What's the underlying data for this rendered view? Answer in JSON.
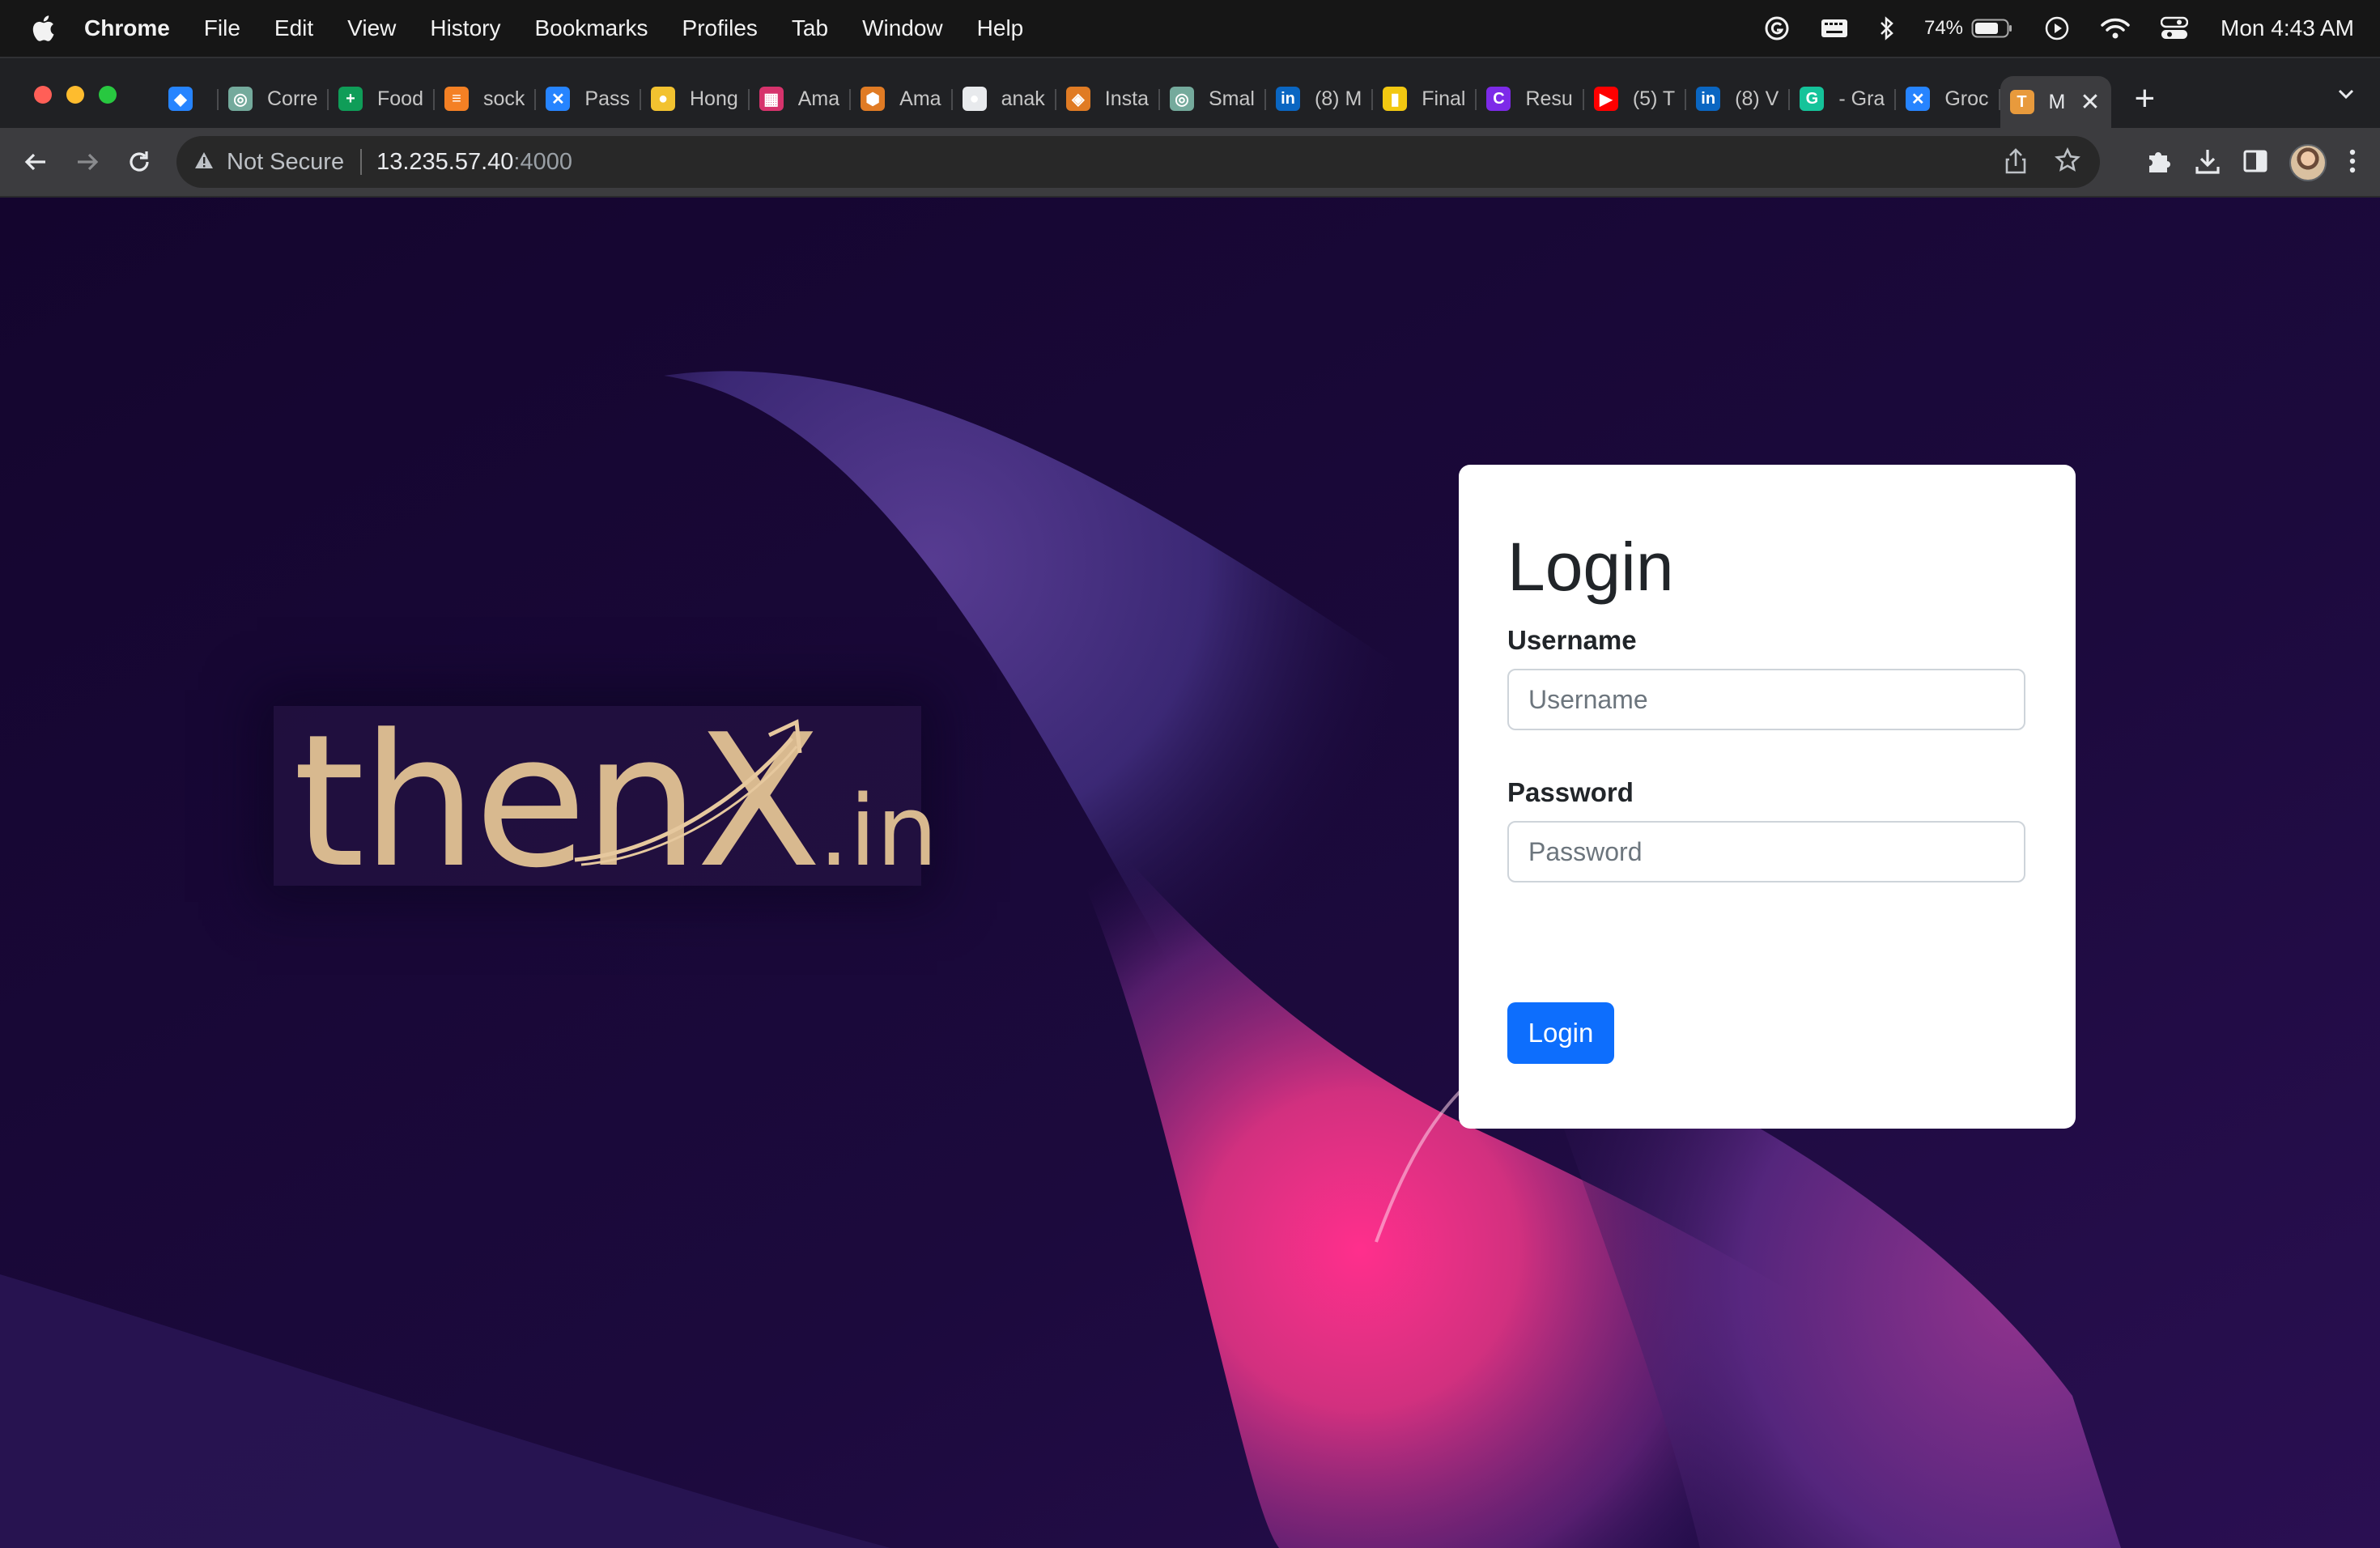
{
  "menubar": {
    "app_name": "Chrome",
    "items": [
      "File",
      "Edit",
      "View",
      "History",
      "Bookmarks",
      "Profiles",
      "Tab",
      "Window",
      "Help"
    ],
    "battery": "74%",
    "clock": "Mon 4:43 AM"
  },
  "tabs": [
    {
      "title": "",
      "icon": "jira-icon",
      "color": "#2684ff"
    },
    {
      "title": "Corre",
      "icon": "chatgpt-icon",
      "color": "#74aa9c"
    },
    {
      "title": "Food",
      "icon": "sheets-icon",
      "color": "#0f9d58"
    },
    {
      "title": "sock",
      "icon": "stackoverflow-icon",
      "color": "#f48024"
    },
    {
      "title": "Pass",
      "icon": "confluence-icon",
      "color": "#2684ff"
    },
    {
      "title": "Hong",
      "icon": "hongkong-icon",
      "color": "#f2c230"
    },
    {
      "title": "Ama",
      "icon": "calendar-icon",
      "color": "#d6336c"
    },
    {
      "title": "Ama",
      "icon": "aws-box-icon",
      "color": "#e07b24"
    },
    {
      "title": "anak",
      "icon": "github-icon",
      "color": "#e8eaed"
    },
    {
      "title": "Insta",
      "icon": "instance-icon",
      "color": "#e07b24"
    },
    {
      "title": "Smal",
      "icon": "chatgpt-icon",
      "color": "#74aa9c"
    },
    {
      "title": "(8) M",
      "icon": "linkedin-icon",
      "color": "#0a66c2"
    },
    {
      "title": "Final",
      "icon": "powerbi-icon",
      "color": "#f2c811"
    },
    {
      "title": "Resu",
      "icon": "canva-icon",
      "color": "#7d2ae8"
    },
    {
      "title": "(5) T",
      "icon": "youtube-icon",
      "color": "#ff0000"
    },
    {
      "title": "(8) V",
      "icon": "linkedin-icon",
      "color": "#0a66c2"
    },
    {
      "title": "- Gra",
      "icon": "grammarly-icon",
      "color": "#15c39a"
    },
    {
      "title": "Groc",
      "icon": "confluence-icon",
      "color": "#2684ff"
    },
    {
      "title": "M",
      "icon": "thenx-icon",
      "color": "#e89a3c",
      "active": true
    }
  ],
  "address_bar": {
    "security": "Not Secure",
    "host": "13.235.57.40",
    "port": ":4000"
  },
  "logo": {
    "text_main": "thenX",
    "text_suffix": ".in",
    "color": "#d8b98f"
  },
  "login_form": {
    "title": "Login",
    "username_label": "Username",
    "username_placeholder": "Username",
    "password_label": "Password",
    "password_placeholder": "Password",
    "submit_label": "Login",
    "button_color": "#0d6efd"
  }
}
